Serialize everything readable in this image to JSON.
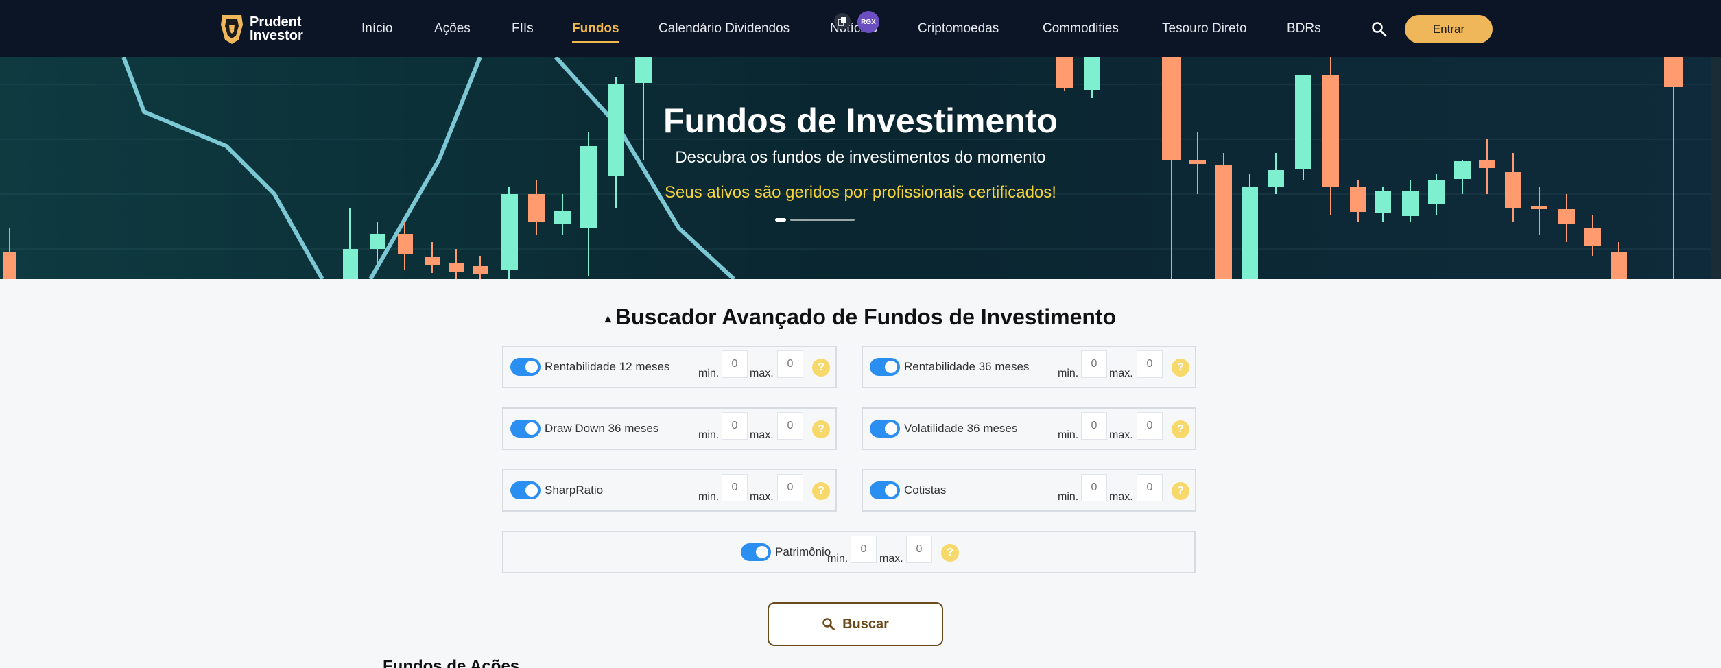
{
  "nav": {
    "brand_line1": "Prudent",
    "brand_line2": "Investor",
    "items": [
      {
        "label": "Início"
      },
      {
        "label": "Ações"
      },
      {
        "label": "FIIs"
      },
      {
        "label": "Fundos"
      },
      {
        "label": "Calendário Dividendos"
      },
      {
        "label": "Notícias"
      },
      {
        "label": "Criptomoedas"
      },
      {
        "label": "Commodities"
      },
      {
        "label": "Tesouro Direto"
      },
      {
        "label": "BDRs"
      }
    ],
    "active": "Fundos",
    "login_label": "Entrar",
    "search_icon": "search-icon",
    "overlay_badge": "RGX"
  },
  "hero": {
    "title": "Fundos de Investimento",
    "subtitle": "Descubra os fundos de investimentos do momento",
    "tagline": "Seus ativos são geridos por profissionais certificados!",
    "tagline_color": "#f6d33a"
  },
  "finder": {
    "title": "Buscador Avançado de Fundos de Investimento",
    "min_label": "min.",
    "max_label": "max.",
    "filters": [
      {
        "label": "Rentabilidade 12 meses",
        "enabled": true,
        "min": "0",
        "max": "0"
      },
      {
        "label": "Rentabilidade 36 meses",
        "enabled": true,
        "min": "0",
        "max": "0"
      },
      {
        "label": "Draw Down 36 meses",
        "enabled": true,
        "min": "0",
        "max": "0"
      },
      {
        "label": "Volatilidade 36 meses",
        "enabled": true,
        "min": "0",
        "max": "0"
      },
      {
        "label": "SharpRatio",
        "enabled": true,
        "min": "0",
        "max": "0"
      },
      {
        "label": "Cotistas",
        "enabled": true,
        "min": "0",
        "max": "0"
      },
      {
        "label": "Patrimônio",
        "enabled": true,
        "min": "0",
        "max": "0"
      }
    ],
    "help_symbol": "?",
    "search_label": "Buscar"
  },
  "section": {
    "heading": "Fundos de Ações"
  },
  "colors": {
    "accent": "#f2b84b",
    "toggle": "#2b8ff2",
    "button_border": "#6a4a1a"
  }
}
